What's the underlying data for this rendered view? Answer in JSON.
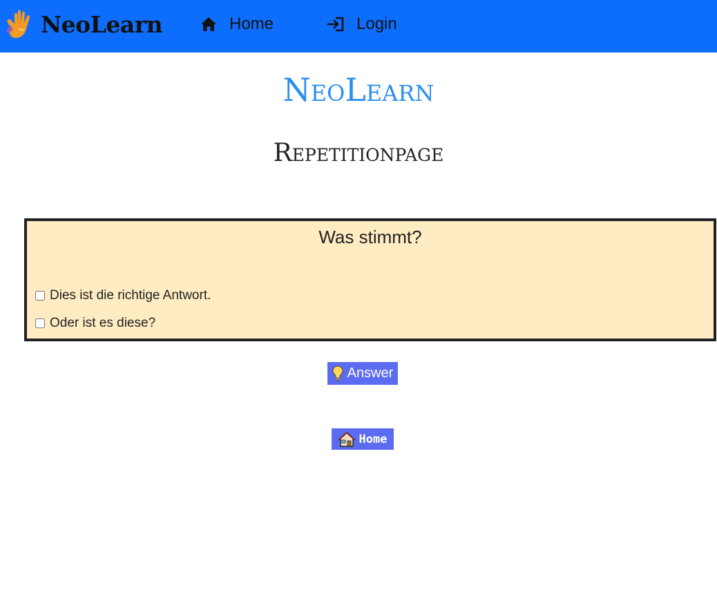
{
  "navbar": {
    "brand_name": "NeoLearn",
    "brand_icon": "hand-logo-icon",
    "home_icon": "home-icon",
    "home_label": "Home",
    "login_icon": "login-icon",
    "login_label": "Login"
  },
  "header": {
    "site_title": "NeoLearn",
    "page_title": "Repetitionpage"
  },
  "quiz": {
    "question": "Was stimmt?",
    "options": [
      {
        "label": "Dies ist die richtige Antwort.",
        "checked": false
      },
      {
        "label": "Oder ist es diese?",
        "checked": false
      }
    ]
  },
  "actions": {
    "answer_icon": "lightbulb-icon",
    "answer_label": "Answer",
    "home_icon": "house-icon",
    "home_label": "Home"
  },
  "colors": {
    "navbar_bg": "#0d6efd",
    "site_title": "#2a8df0",
    "card_bg": "#ffecc2",
    "button_bg": "#5b6cf0"
  }
}
